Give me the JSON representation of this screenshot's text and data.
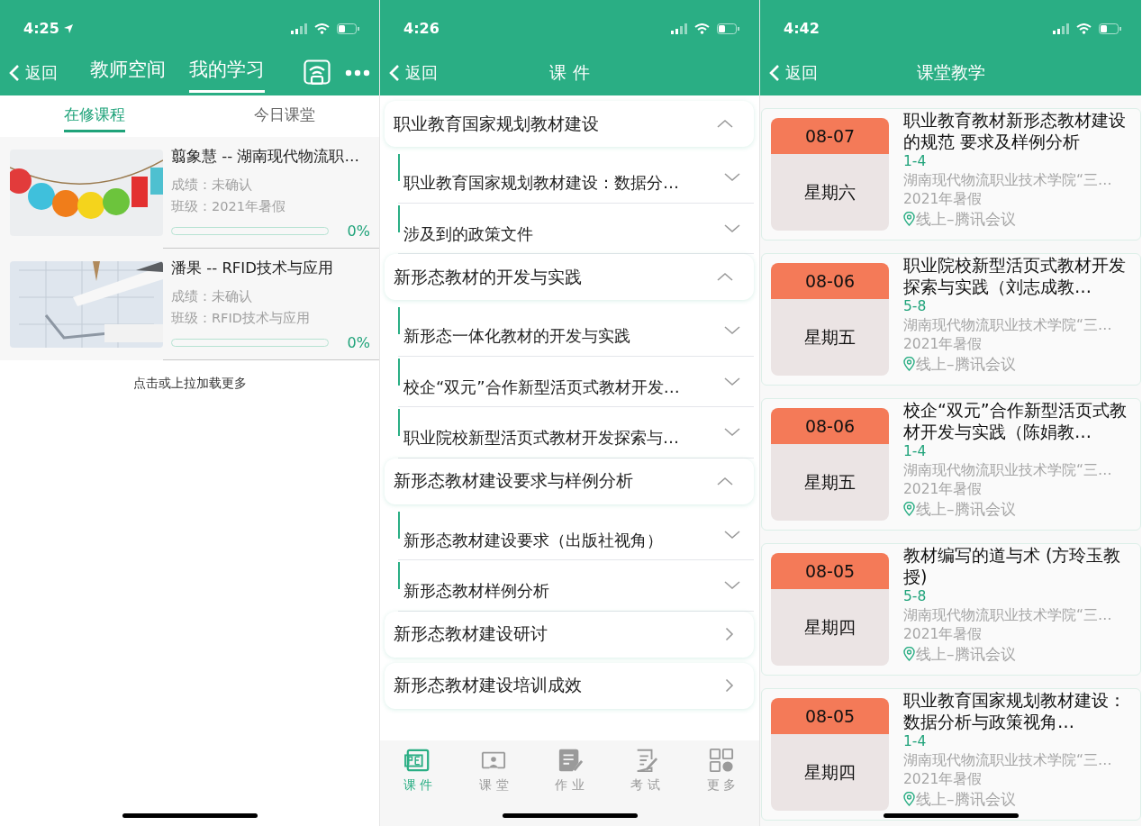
{
  "screens": [
    {
      "kind": "learning",
      "status_bar": {
        "time": "4:25",
        "location_arrow": true
      },
      "nav": {
        "back": "返回",
        "tabs": [
          {
            "label": "教师空间",
            "selected": false
          },
          {
            "label": "我的学习",
            "selected": true
          }
        ]
      },
      "subtabs": [
        {
          "label": "在修课程",
          "selected": true
        },
        {
          "label": "今日课堂",
          "selected": false
        }
      ],
      "courses": [
        {
          "title": "翦象慧 -- 湖南现代物流职…",
          "grade": "成绩：未确认",
          "class": "班级：2021年暑假",
          "level": 0,
          "percent": "0%"
        },
        {
          "title": "潘果 -- RFID技术与应用",
          "grade": "成绩：未确认",
          "class": "班级：RFID技术与应用",
          "level": 0,
          "percent": "0%"
        }
      ],
      "load_more": "点击或上拉加载更多"
    },
    {
      "kind": "courseware",
      "status_bar": {
        "time": "4:26",
        "location_arrow": false
      },
      "nav": {
        "back": "返回",
        "title": "课 件"
      },
      "sections": [
        {
          "kind": "folder",
          "title": "职业教育国家规划教材建设",
          "expanded": true,
          "children": [
            {
              "title": "职业教育国家规划教材建设：数据分…",
              "expanded": false
            },
            {
              "title": "涉及到的政策文件",
              "expanded": false
            }
          ]
        },
        {
          "kind": "folder",
          "title": "新形态教材的开发与实践",
          "expanded": true,
          "children": [
            {
              "title": "新形态一体化教材的开发与实践",
              "expanded": false
            },
            {
              "title": "校企“双元”合作新型活页式教材开发…",
              "expanded": false
            },
            {
              "title": "职业院校新型活页式教材开发探索与…",
              "expanded": false
            }
          ]
        },
        {
          "kind": "folder",
          "title": "新形态教材建设要求与样例分析",
          "expanded": true,
          "children": [
            {
              "title": "新形态教材建设要求（出版社视角）",
              "expanded": false
            },
            {
              "title": "新形态教材样例分析",
              "expanded": false
            }
          ]
        },
        {
          "kind": "link",
          "title": "新形态教材建设研讨"
        },
        {
          "kind": "link",
          "title": "新形态教材建设培训成效"
        }
      ],
      "tabbar": [
        {
          "label": "课 件",
          "selected": true
        },
        {
          "label": "课 堂",
          "selected": false
        },
        {
          "label": "作 业",
          "selected": false
        },
        {
          "label": "考 试",
          "selected": false
        },
        {
          "label": "更 多",
          "selected": false
        }
      ]
    },
    {
      "kind": "lessons",
      "status_bar": {
        "time": "4:42",
        "location_arrow": false
      },
      "nav": {
        "back": "返回",
        "title": "课堂教学"
      },
      "lessons": [
        {
          "date": "08-07",
          "weekday": "星期六",
          "title": "职业教育教材新形态教材建设的规范 要求及样例分析",
          "periods": "1-4",
          "school": "湖南现代物流职业技术学院“三…",
          "term": "2021年暑假",
          "location": "线上–腾讯会议"
        },
        {
          "date": "08-06",
          "weekday": "星期五",
          "title": "职业院校新型活页式教材开发探索与实践（刘志成教…",
          "periods": "5-8",
          "school": "湖南现代物流职业技术学院“三…",
          "term": "2021年暑假",
          "location": "线上–腾讯会议"
        },
        {
          "date": "08-06",
          "weekday": "星期五",
          "title": "校企“双元”合作新型活页式教材开发与实践（陈娟教…",
          "periods": "1-4",
          "school": "湖南现代物流职业技术学院“三…",
          "term": "2021年暑假",
          "location": "线上–腾讯会议"
        },
        {
          "date": "08-05",
          "weekday": "星期四",
          "title": "教材编写的道与术 (方玲玉教授)",
          "periods": "5-8",
          "school": "湖南现代物流职业技术学院“三…",
          "term": "2021年暑假",
          "location": "线上–腾讯会议"
        },
        {
          "date": "08-05",
          "weekday": "星期四",
          "title": "职业教育国家规划教材建设：数据分析与政策视角…",
          "periods": "1-4",
          "school": "湖南现代物流职业技术学院“三…",
          "term": "2021年暑假",
          "location": "线上–腾讯会议"
        }
      ]
    }
  ]
}
